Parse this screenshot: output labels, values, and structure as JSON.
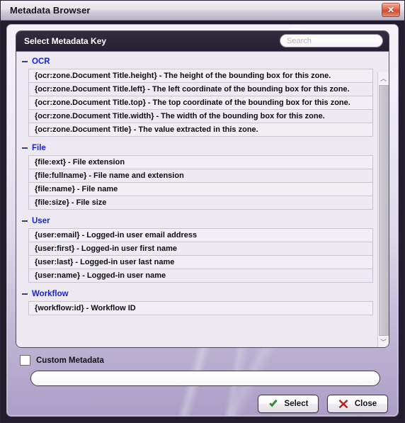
{
  "window": {
    "title": "Metadata Browser",
    "close_icon": "close-icon",
    "close_glyph": "✕"
  },
  "panel": {
    "title": "Select Metadata Key",
    "search": {
      "placeholder": "Search",
      "value": ""
    },
    "scrollbar": {
      "up_glyph": "︿",
      "down_glyph": "﹀"
    },
    "collapse_glyph": "−",
    "groups": [
      {
        "label": "OCR",
        "expanded": true,
        "items": [
          {
            "key": "{ocr:zone.Document Title.height}",
            "sep": "-",
            "desc": "The height of the bounding box for this zone."
          },
          {
            "key": "{ocr:zone.Document Title.left}",
            "sep": "-",
            "desc": "The left coordinate of the bounding box for this zone."
          },
          {
            "key": "{ocr:zone.Document Title.top}",
            "sep": "-",
            "desc": "The top coordinate of the bounding box for this zone."
          },
          {
            "key": "{ocr:zone.Document Title.width}",
            "sep": "-",
            "desc": "The width of the bounding box for this zone."
          },
          {
            "key": "{ocr:zone.Document Title}",
            "sep": "-",
            "desc": "The value extracted in this zone."
          }
        ]
      },
      {
        "label": "File",
        "expanded": true,
        "items": [
          {
            "key": "{file:ext}",
            "sep": "-",
            "desc": "File extension"
          },
          {
            "key": "{file:fullname}",
            "sep": "-",
            "desc": "File name and extension"
          },
          {
            "key": "{file:name}",
            "sep": "-",
            "desc": "File name"
          },
          {
            "key": "{file:size}",
            "sep": "-",
            "desc": "File size"
          }
        ]
      },
      {
        "label": "User",
        "expanded": true,
        "items": [
          {
            "key": "{user:email}",
            "sep": "-",
            "desc": "Logged-in user email address"
          },
          {
            "key": "{user:first}",
            "sep": "-",
            "desc": "Logged-in user first name"
          },
          {
            "key": "{user:last}",
            "sep": "-",
            "desc": "Logged-in user last name"
          },
          {
            "key": "{user:name}",
            "sep": "-",
            "desc": "Logged-in user name"
          }
        ]
      },
      {
        "label": "Workflow",
        "expanded": true,
        "items": [
          {
            "key": "{workflow:id}",
            "sep": "-",
            "desc": "Workflow ID"
          }
        ]
      }
    ]
  },
  "custom_metadata": {
    "label": "Custom Metadata",
    "checked": false,
    "input_value": "",
    "input_placeholder": ""
  },
  "footer": {
    "select_label": "Select",
    "close_label": "Close",
    "select_icon": "green-check-icon",
    "close_icon": "red-x-icon"
  },
  "colors": {
    "accent_purple": "#aa9ec6",
    "group_label_blue": "#1a21e0",
    "title_bar_dark": "#2c2537",
    "select_green": "#2f9b2f",
    "close_red": "#cc1b1b"
  }
}
